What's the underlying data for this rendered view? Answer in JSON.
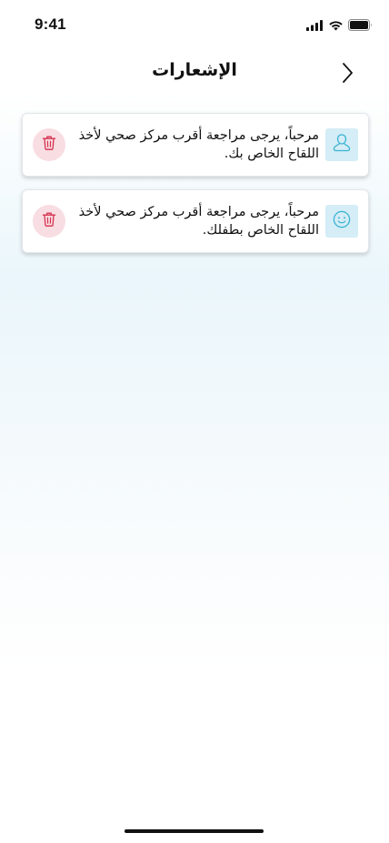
{
  "status_bar": {
    "time": "9:41",
    "icons": [
      "cellular-signal-icon",
      "wifi-icon",
      "battery-icon"
    ]
  },
  "header": {
    "title": "الإشعارات",
    "back_icon": "chevron-right-icon"
  },
  "notifications": [
    {
      "type_icon": "user-icon",
      "line1": "مرحباً، يرجى مراجعة أقرب مركز صحي لأخذ",
      "line2": "اللقاح الخاص بك.",
      "delete_icon": "trash-icon"
    },
    {
      "type_icon": "smiley-face-icon",
      "line1": "مرحباً، يرجى مراجعة أقرب مركز صحي لأخذ",
      "line2": "اللقاح الخاص بطفلك.",
      "delete_icon": "trash-icon"
    }
  ],
  "colors": {
    "accent_teal": "#3bb3d3",
    "icon_tile_bg": "#d4edf6",
    "delete_bg": "#f8dde2",
    "delete_icon": "#d6314f"
  }
}
